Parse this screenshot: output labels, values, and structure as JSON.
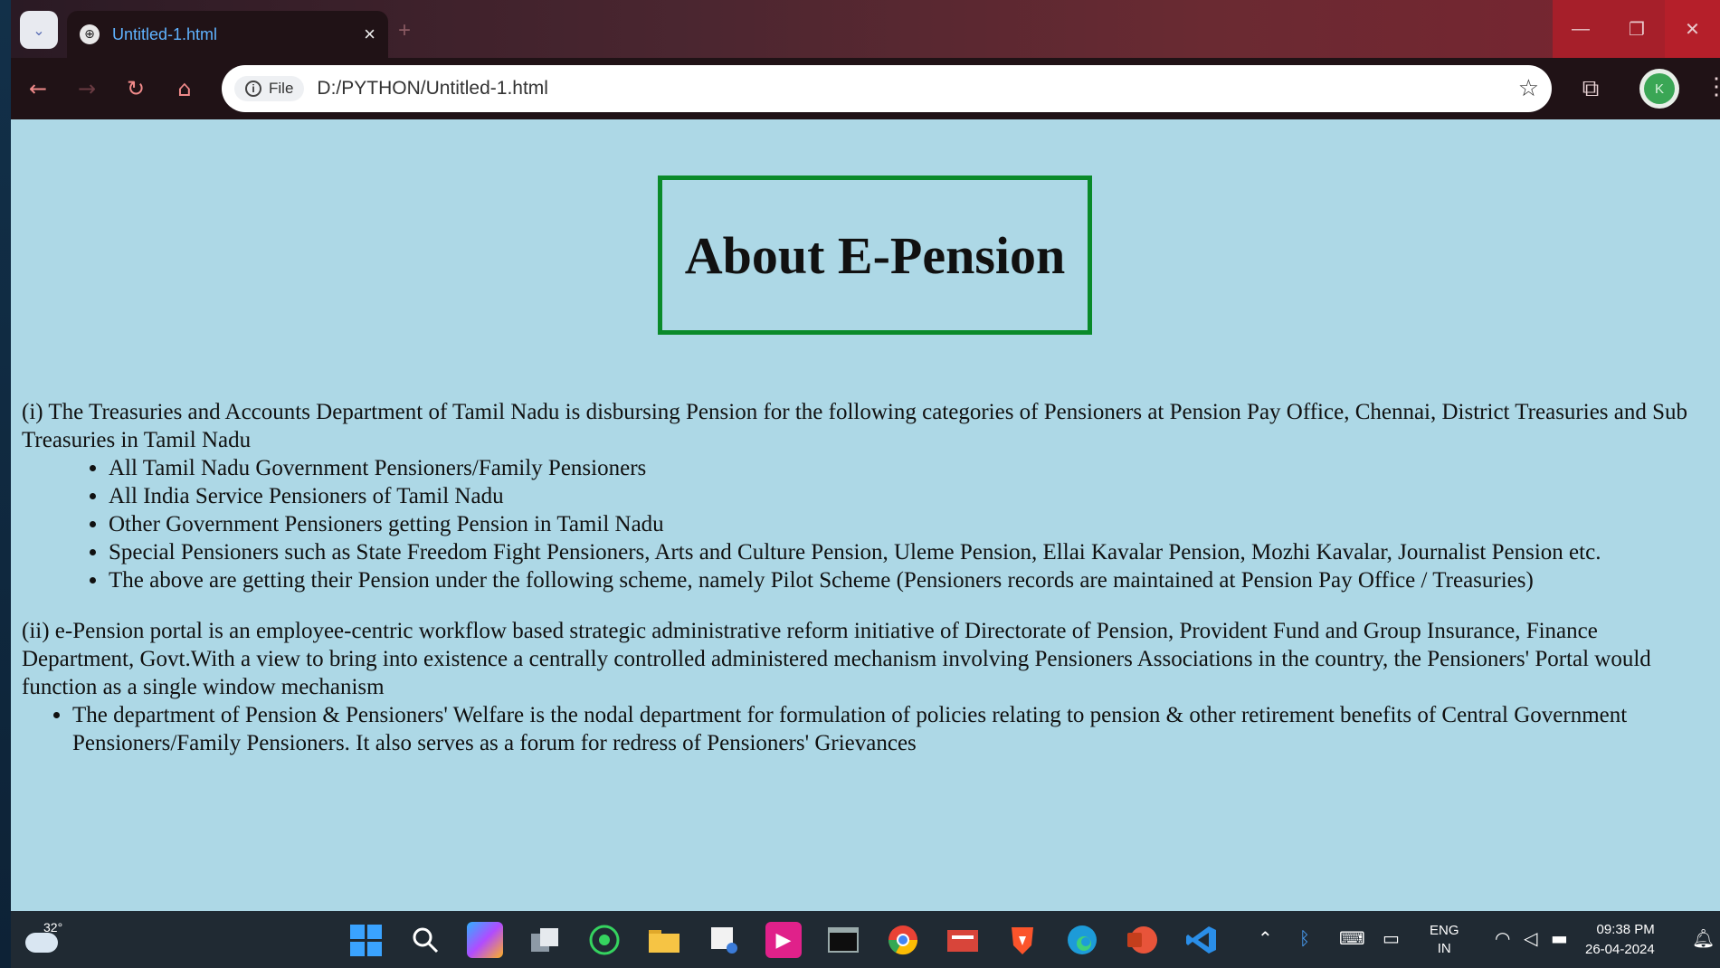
{
  "browser": {
    "tab_title": "Untitled-1.html",
    "tab_close": "×",
    "new_tab": "+",
    "url_chip": "File",
    "url": "D:/PYTHON/Untitled-1.html",
    "avatar_initial": "K",
    "window_min": "—",
    "window_max": "❐",
    "window_close": "✕"
  },
  "page": {
    "heading": "About E-Pension",
    "para1": "(i) The Treasuries and Accounts Department of Tamil Nadu is disbursing Pension for the following categories of Pensioners at Pension Pay Office, Chennai, District Treasuries and Sub Treasuries in Tamil Nadu",
    "list1": [
      "All Tamil Nadu Government Pensioners/Family Pensioners",
      "All India Service Pensioners of Tamil Nadu",
      "Other Government Pensioners getting Pension in Tamil Nadu",
      "Special Pensioners such as State Freedom Fight Pensioners, Arts and Culture Pension, Uleme Pension, Ellai Kavalar Pension, Mozhi Kavalar, Journalist Pension etc.",
      "The above are getting their Pension under the following scheme, namely Pilot Scheme (Pensioners records are maintained at Pension Pay Office / Treasuries)"
    ],
    "para2": "(ii) e-Pension portal is an employee-centric workflow based strategic administrative reform initiative of Directorate of Pension, Provident Fund and Group Insurance, Finance Department, Govt.With a view to bring into existence a centrally controlled administered mechanism involving Pensioners Associations in the country, the Pensioners' Portal would function as a single window mechanism",
    "list2": [
      "The department of Pension & Pensioners' Welfare is the nodal department for formulation of policies relating to pension & other retirement benefits of Central Government Pensioners/Family Pensioners. It also serves as a forum for redress of Pensioners' Grievances"
    ]
  },
  "taskbar": {
    "weather_temp": "32°",
    "lang_top": "ENG",
    "lang_bottom": "IN",
    "time": "09:38 PM",
    "date": "26-04-2024",
    "apps": [
      "start-icon",
      "search-icon",
      "copilot-icon",
      "task-view-icon",
      "whatsapp-icon",
      "file-explorer-icon",
      "snipping-tool-icon",
      "media-app-icon",
      "terminal-icon",
      "chrome-icon",
      "store-icon",
      "brave-icon",
      "edge-icon",
      "powerpoint-icon",
      "vscode-icon"
    ]
  },
  "colors": {
    "page_background": "#add8e6",
    "heading_border": "#0a8a2a",
    "tab_title": "#5fb3ff"
  }
}
